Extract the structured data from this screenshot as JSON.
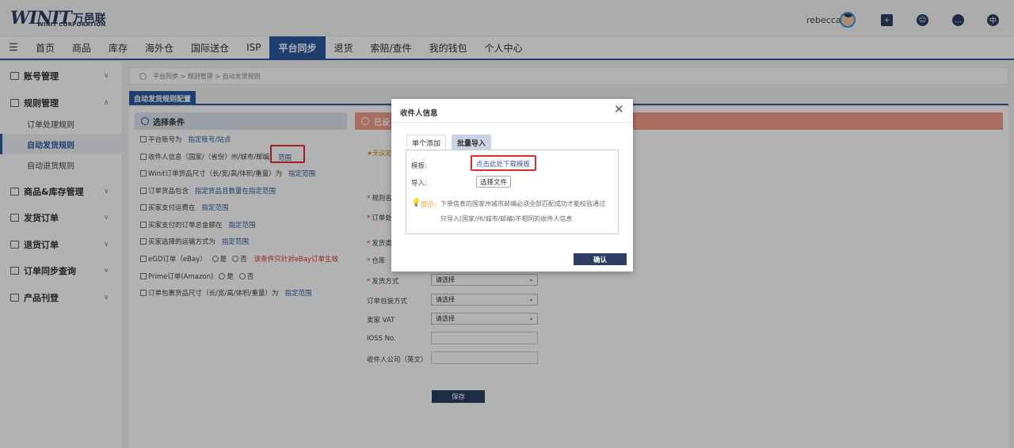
{
  "header": {
    "logo_mark": "WINIT",
    "logo_cn": "万邑联",
    "logo_sub": "WINIT CORPORATION",
    "username": "rebecca",
    "lang_icon_char": "中"
  },
  "nav": {
    "items": [
      "首页",
      "商品",
      "库存",
      "海外仓",
      "国际送仓",
      "ISP",
      "平台同步",
      "退货",
      "索赔/查件",
      "我的钱包",
      "个人中心"
    ],
    "active_index": 6
  },
  "sidebar": {
    "groups": [
      "账号管理",
      "规则管理",
      "商品&库存管理",
      "发货订单",
      "退货订单",
      "订单同步查询",
      "产品刊登"
    ],
    "sub_items": [
      "订单处理规则",
      "自动发货规则",
      "自动退货规则"
    ]
  },
  "breadcrumb": "平台同步 > 规则管理 > 自动发货规则",
  "tab_label": "自动发货规则配置",
  "left_panel": {
    "title": "选择条件",
    "conditions": [
      {
        "label": "平台账号为",
        "link": "指定账号/站点"
      },
      {
        "label": "收件人信息（国家/（省份）州/城市/邮编）",
        "link": "范围"
      },
      {
        "label": "Winit订单货品尺寸（长/宽/高/体积/重量）为",
        "link": "指定范围"
      },
      {
        "label": "订单货品包含",
        "link": "指定货品且数量在指定范围"
      },
      {
        "label": "买家支付运费在",
        "link": "指定范围"
      },
      {
        "label": "买家支付的订单总金额在",
        "link": "指定范围"
      },
      {
        "label": "买家选择的运输方式为",
        "link": "指定范围"
      },
      {
        "label": "eGD订单（eBay）",
        "yes": "是",
        "no": "否",
        "warn": "该条件只针对eBay订单生效"
      },
      {
        "label": "Prime订单(Amazon)",
        "yes": "是",
        "no": "否"
      },
      {
        "label": "订单包裹货品尺寸（长/宽/高/体积/重量）为",
        "link": "指定范围"
      }
    ]
  },
  "right_panel": {
    "title": "已设",
    "warning": "无设定",
    "fields": [
      {
        "label": "规则名",
        "required": true
      },
      {
        "label": "订单处",
        "required": true
      },
      {
        "label": "发货类",
        "required": true
      },
      {
        "label": "仓库",
        "required": true
      },
      {
        "label": "发货方式",
        "required": true,
        "value": "请选择"
      },
      {
        "label": "订单包装方式",
        "required": false,
        "value": "请选择"
      },
      {
        "label": "卖家 VAT",
        "required": false,
        "value": "请选择"
      },
      {
        "label": "IOSS No.",
        "required": false
      },
      {
        "label": "收件人公司（英文）",
        "required": false
      }
    ],
    "save_label": "保存"
  },
  "modal": {
    "title": "收件人信息",
    "tabs": [
      "单个添加",
      "批量导入"
    ],
    "template_label": "模板:",
    "template_link": "点击此处下载模板",
    "import_label": "导入:",
    "file_button": "选择文件",
    "tip_label": "提示:",
    "tip_line1": "下单信息的国家州城市邮编必须全部匹配成功才能校验通过",
    "tip_line2": "只导入(国家/州/城市/邮编)不相同的收件人信息",
    "confirm_label": "确认"
  },
  "colors": {
    "primary": "#2c5aa0",
    "dark": "#2c3e64",
    "highlight_red": "#e02b2b",
    "warn_orange": "#f0a020"
  }
}
